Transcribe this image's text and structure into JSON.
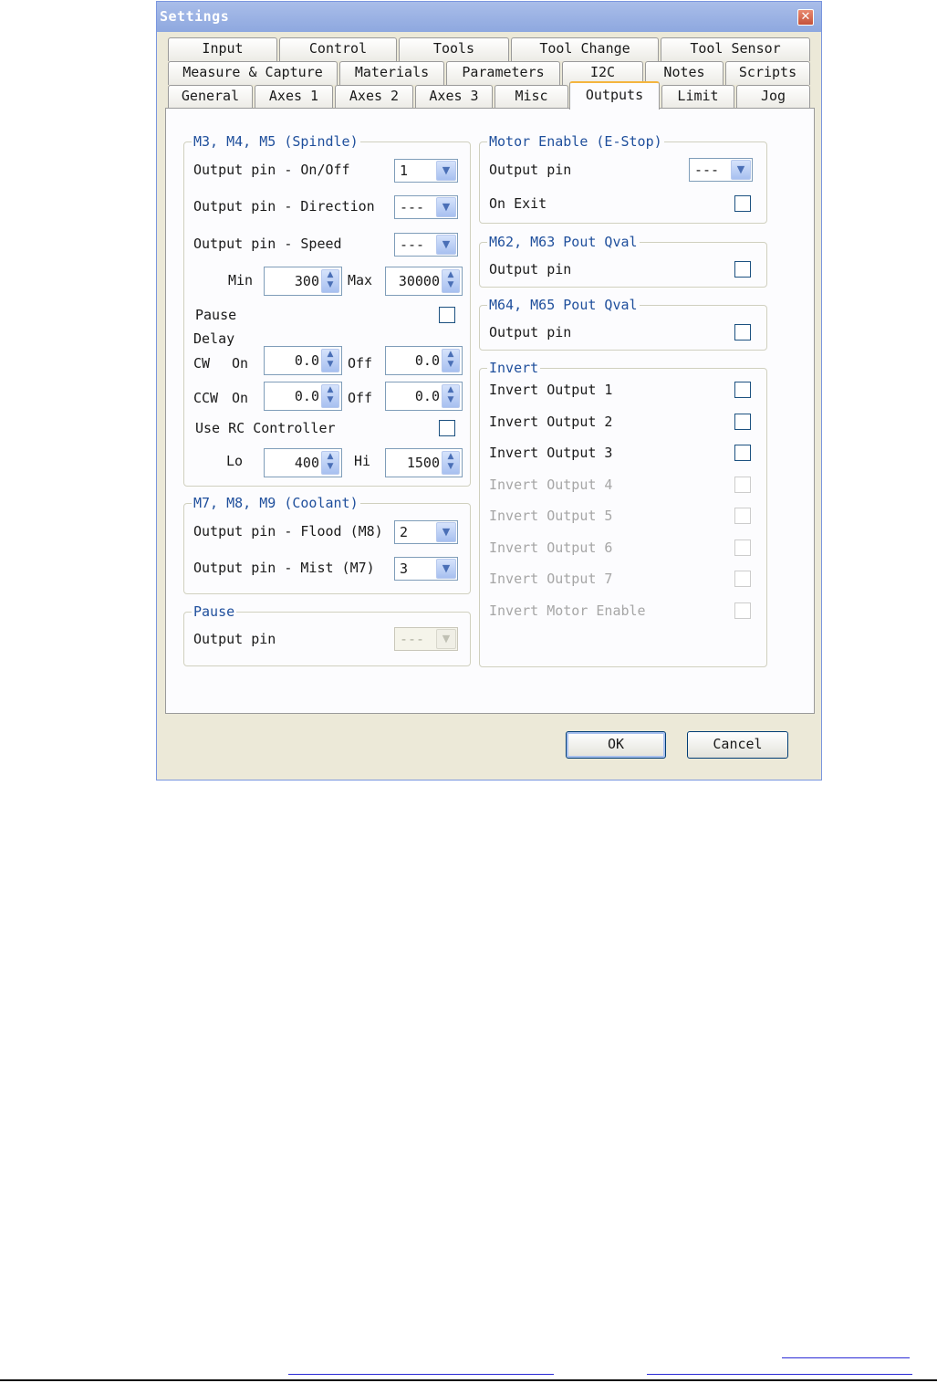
{
  "window": {
    "title": "Settings",
    "close_glyph": "✕"
  },
  "tabs": {
    "row1": [
      "Input",
      "Control",
      "Tools",
      "Tool Change",
      "Tool Sensor"
    ],
    "row2": [
      "Measure & Capture",
      "Materials",
      "Parameters",
      "I2C",
      "Notes",
      "Scripts"
    ],
    "row3": [
      "General",
      "Axes 1",
      "Axes 2",
      "Axes 3",
      "Misc",
      "Outputs",
      "Limit",
      "Jog"
    ],
    "active": "Outputs"
  },
  "spindle": {
    "title": "M3, M4, M5 (Spindle)",
    "onoff_label": "Output pin - On/Off",
    "onoff_value": "1",
    "direction_label": "Output pin - Direction",
    "direction_value": "---",
    "speed_label": "Output pin - Speed",
    "speed_value": "---",
    "min_label": "Min",
    "min_value": "300",
    "max_label": "Max",
    "max_value": "30000",
    "pause_label": "Pause",
    "pause_checked": false,
    "delay_label": "Delay",
    "cw_label": "CW",
    "cw_on_label": "On",
    "cw_on_value": "0.0",
    "cw_off_label": "Off",
    "cw_off_value": "0.0",
    "ccw_label": "CCW",
    "ccw_on_label": "On",
    "ccw_on_value": "0.0",
    "ccw_off_label": "Off",
    "ccw_off_value": "0.0",
    "rc_label": "Use RC Controller",
    "rc_checked": false,
    "lo_label": "Lo",
    "lo_value": "400",
    "hi_label": "Hi",
    "hi_value": "1500"
  },
  "coolant": {
    "title": "M7, M8, M9 (Coolant)",
    "flood_label": "Output pin - Flood (M8)",
    "flood_value": "2",
    "mist_label": "Output pin - Mist (M7)",
    "mist_value": "3"
  },
  "pause_group": {
    "title": "Pause",
    "output_label": "Output pin",
    "output_value": "---"
  },
  "motor_enable": {
    "title": "Motor Enable (E-Stop)",
    "output_label": "Output pin",
    "output_value": "---",
    "on_exit_label": "On Exit",
    "on_exit_checked": false
  },
  "m62": {
    "title": "M62, M63 Pout Qval",
    "output_label": "Output pin"
  },
  "m64": {
    "title": "M64, M65 Pout Qval",
    "output_label": "Output pin"
  },
  "invert": {
    "title": "Invert",
    "items": [
      "Invert Output 1",
      "Invert Output 2",
      "Invert Output 3",
      "Invert Output 4",
      "Invert Output 5",
      "Invert Output 6",
      "Invert Output 7",
      "Invert Motor Enable"
    ]
  },
  "buttons": {
    "ok": "OK",
    "cancel": "Cancel"
  },
  "icons": {
    "dropdown": "chevron-down-icon",
    "spin": "spin-updown-icon",
    "close": "close-icon"
  },
  "colors": {
    "titlebar": "#8ea8df",
    "group_title": "#1f4f9c",
    "active_tab_accent": "#f4b53e",
    "dialog_bg": "#ece9d8"
  }
}
